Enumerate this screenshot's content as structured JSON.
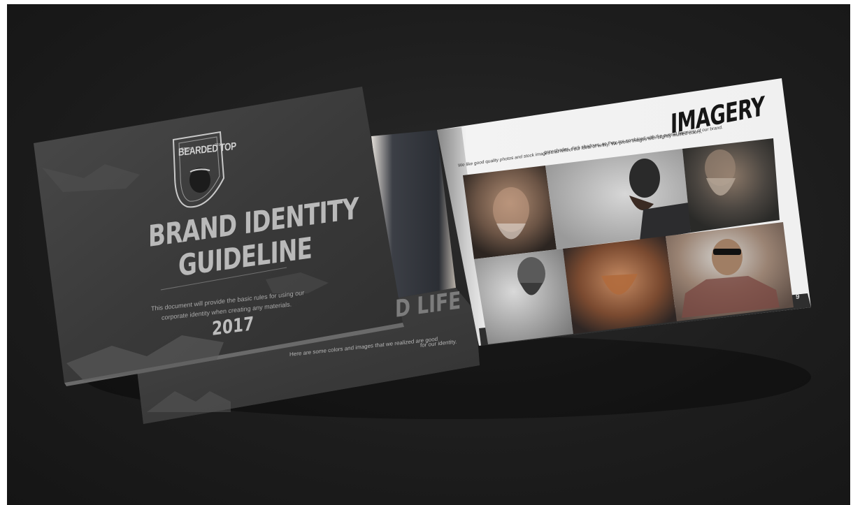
{
  "scene": {
    "background_color": "#1d1d1d",
    "page_color": "#f2f2f2"
  },
  "cover": {
    "logo_text": "BEARDED TOP",
    "logo_since": "SINCE",
    "logo_year": "2016",
    "title_line1": "BRAND IDENTITY",
    "title_line2": "GUIDELINE",
    "description_line1": "This document will provide the basic rules for using our",
    "description_line2": "corporate identity when creating any materials.",
    "year": "2017"
  },
  "back_page": {
    "heading_partial": "D LIFE",
    "description_line1": "Here are some colors and images that we realized are good",
    "description_line2": "for our identity."
  },
  "imagery_page": {
    "title": "IMAGERY",
    "description_line1": "We like good quality photos and stock images that reflect our ideal of virility. We prefer images with slightly muffled colors,",
    "description_line2": "gray shades, dark shadows, so they are combined with the overall harmony of our brand.",
    "page_number": "9",
    "photos": [
      {
        "subject": "bearded-man-portrait-1",
        "tone": "#6a5a4e"
      },
      {
        "subject": "bearded-man-profile",
        "tone": "#8a8a8a"
      },
      {
        "subject": "bearded-man-dark",
        "tone": "#3c3a36"
      },
      {
        "subject": "bearded-man-bw",
        "tone": "#a9a9a9"
      },
      {
        "subject": "bearded-man-red-beard",
        "tone": "#7a4a30"
      },
      {
        "subject": "bald-man-sunglasses",
        "tone": "#7c6a5e"
      }
    ]
  }
}
